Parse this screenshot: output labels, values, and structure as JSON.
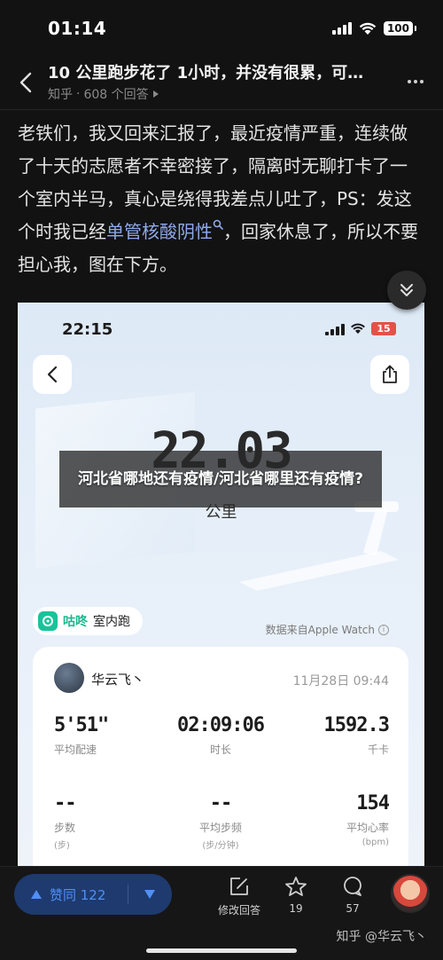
{
  "status": {
    "time": "01:14",
    "battery": "100"
  },
  "header": {
    "title": "10 公里跑步花了 1小时，并没有很累，可…",
    "source": "知乎",
    "answer_count": "608 个回答"
  },
  "answer": {
    "text_before": "老铁们，我又回来汇报了，最近疫情严重，连续做了十天的志愿者不幸密接了，隔离时无聊打卡了一个室内半马，真心是绕得我差点儿吐了，PS：发这个时我已经",
    "keyword": "单管核酸阴性",
    "text_after": "，回家休息了，所以不要担心我，图在下方。"
  },
  "screenshot": {
    "time": "22:15",
    "battery": "15",
    "distance": "22.03",
    "distance_unit": "公里",
    "app_name": "咕咚",
    "activity": "室内跑",
    "source_note": "数据来自Apple Watch",
    "user_name": "华云飞丶",
    "date": "11月28日 09:44",
    "stats": [
      {
        "value": "5'51\"",
        "label": "平均配速",
        "unit": ""
      },
      {
        "value": "02:09:06",
        "label": "时长",
        "unit": ""
      },
      {
        "value": "1592.3",
        "label": "千卡",
        "unit": ""
      },
      {
        "value": "--",
        "label": "步数",
        "unit": "(步)"
      },
      {
        "value": "--",
        "label": "平均步频",
        "unit": "(步/分钟)"
      },
      {
        "value": "154",
        "label": "平均心率",
        "unit": "(bpm)"
      }
    ]
  },
  "overlay": {
    "text": "河北省哪地还有疫情/河北省哪里还有疫情?"
  },
  "bottom_bar": {
    "vote_label": "赞同 122",
    "edit_label": "修改回答",
    "favorites": "19",
    "comments": "57",
    "watermark": "知乎 @华云飞丶"
  }
}
